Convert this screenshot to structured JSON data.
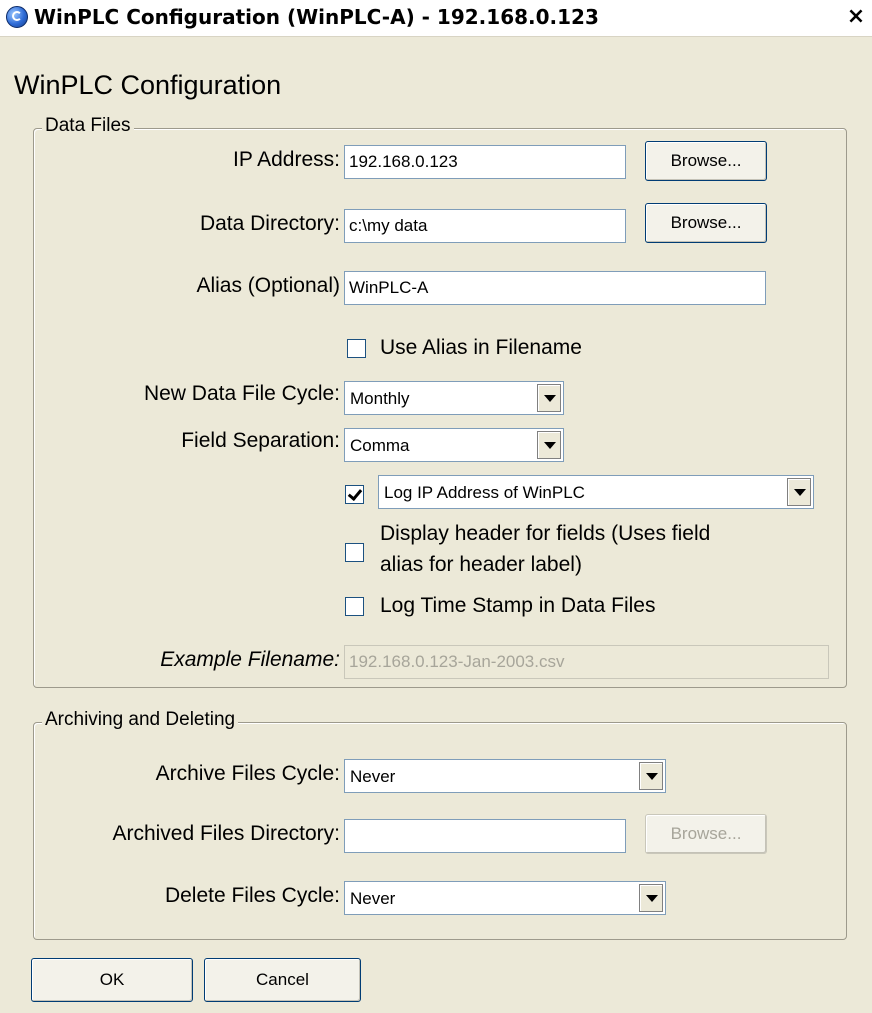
{
  "window": {
    "title": "WinPLC Configuration (WinPLC-A) - 192.168.0.123",
    "close_label": "×"
  },
  "heading": "WinPLC Configuration",
  "data_files": {
    "legend": "Data Files",
    "ip_label": "IP Address:",
    "ip_value": "192.168.0.123",
    "browse_label": "Browse...",
    "dir_label": "Data Directory:",
    "dir_value": "c:\\my data",
    "alias_label": "Alias (Optional)",
    "alias_value": "WinPLC-A",
    "use_alias_label": "Use Alias in Filename",
    "use_alias_checked": false,
    "cycle_label": "New Data File Cycle:",
    "cycle_value": "Monthly",
    "separation_label": "Field Separation:",
    "separation_value": "Comma",
    "log_ip_checked": true,
    "log_ip_value": "Log IP Address of WinPLC",
    "display_header_label_1": "Display header for fields (Uses field",
    "display_header_label_2": "alias for header label)",
    "display_header_checked": false,
    "timestamp_label": "Log Time Stamp in Data Files",
    "timestamp_checked": false,
    "example_label": "Example Filename:",
    "example_value": "192.168.0.123-Jan-2003.csv"
  },
  "archiving": {
    "legend": "Archiving and Deleting",
    "archive_cycle_label": "Archive Files Cycle:",
    "archive_cycle_value": "Never",
    "archived_dir_label": "Archived Files Directory:",
    "archived_dir_value": "",
    "browse_label": "Browse...",
    "delete_cycle_label": "Delete Files Cycle:",
    "delete_cycle_value": "Never"
  },
  "footer": {
    "ok_label": "OK",
    "cancel_label": "Cancel"
  }
}
